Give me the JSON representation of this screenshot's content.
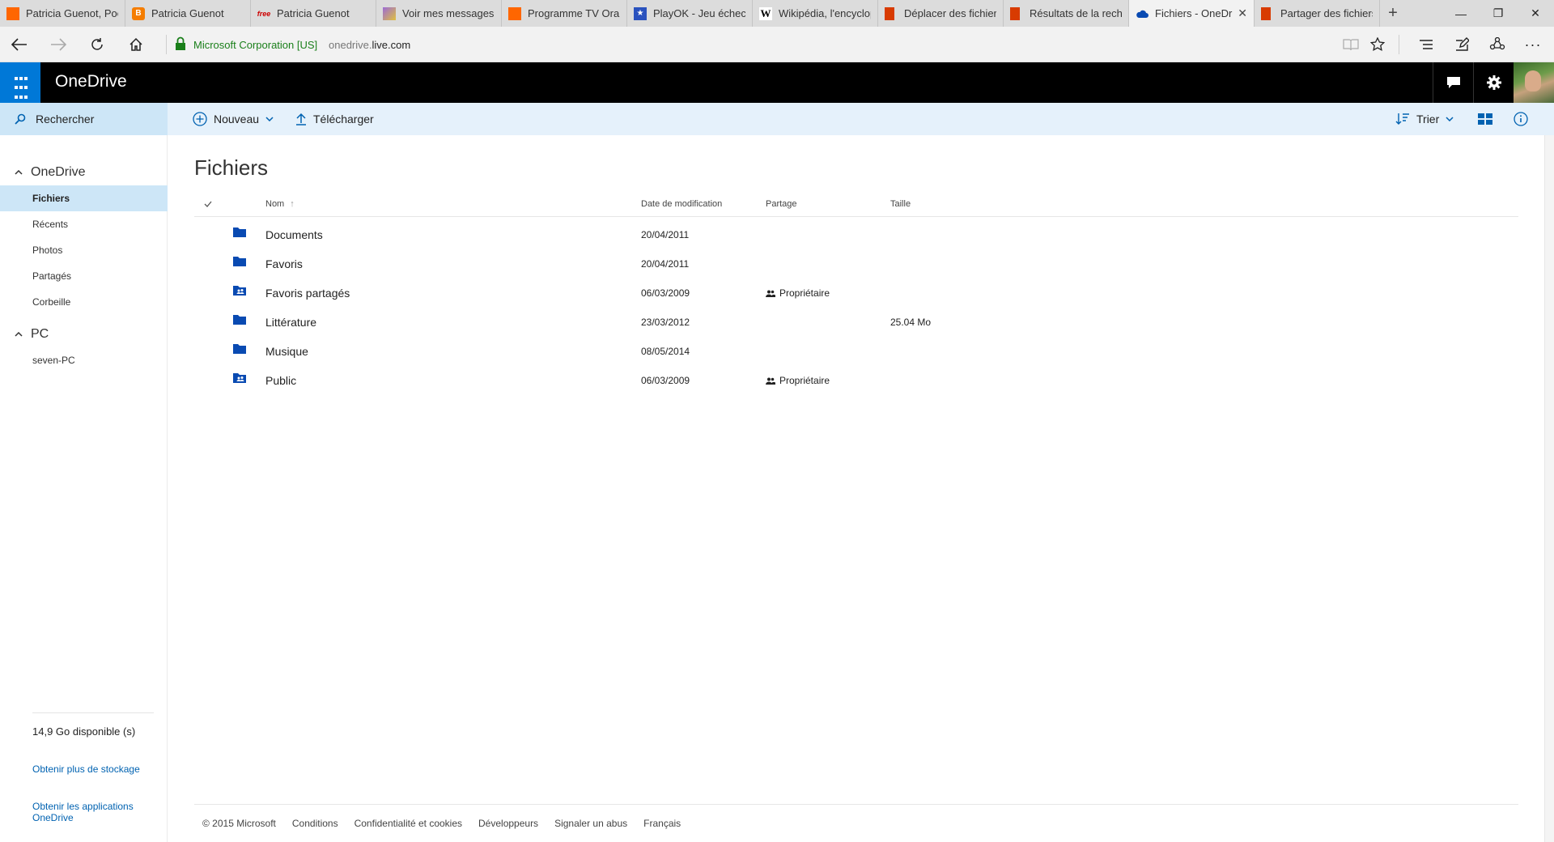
{
  "browser": {
    "tabs": [
      {
        "title": "Patricia Guenot, Poè",
        "favicon_color": "#ff6600",
        "favicon_glyph": ""
      },
      {
        "title": "Patricia Guenot",
        "favicon_color": "#f57d00",
        "favicon_glyph": "B"
      },
      {
        "title": "Patricia Guenot",
        "favicon_color": "#cc0000",
        "favicon_glyph": "free"
      },
      {
        "title": "Voir mes messages",
        "favicon_color": "#9c6bd6",
        "favicon_glyph": ""
      },
      {
        "title": "Programme TV Oran",
        "favicon_color": "#ff6600",
        "favicon_glyph": ""
      },
      {
        "title": "PlayOK - Jeu échecs",
        "favicon_color": "#2a52be",
        "favicon_glyph": "★"
      },
      {
        "title": "Wikipédia, l'encyclop",
        "favicon_color": "#ffffff",
        "favicon_glyph": "W"
      },
      {
        "title": "Déplacer des fichiers",
        "favicon_color": "#d83b01",
        "favicon_glyph": ""
      },
      {
        "title": "Résultats de la reche",
        "favicon_color": "#d83b01",
        "favicon_glyph": ""
      },
      {
        "title": "Fichiers - OneDr",
        "favicon_color": "#094ab2",
        "favicon_glyph": "☁",
        "active": true
      },
      {
        "title": "Partager des fichiers",
        "favicon_color": "#d83b01",
        "favicon_glyph": ""
      }
    ],
    "cert_label": "Microsoft Corporation [US]",
    "url_prefix": "onedrive.",
    "url_domain": "live.com"
  },
  "header": {
    "brand": "OneDrive"
  },
  "commandbar": {
    "search_label": "Rechercher",
    "new_label": "Nouveau",
    "upload_label": "Télécharger",
    "sort_label": "Trier"
  },
  "sidebar": {
    "group_onedrive": "OneDrive",
    "items": [
      {
        "label": "Fichiers",
        "selected": true
      },
      {
        "label": "Récents"
      },
      {
        "label": "Photos"
      },
      {
        "label": "Partagés"
      },
      {
        "label": "Corbeille"
      }
    ],
    "group_pc": "PC",
    "pc_items": [
      {
        "label": "seven-PC"
      }
    ],
    "quota": "14,9 Go disponible (s)",
    "more_storage": "Obtenir plus de stockage",
    "get_apps": "Obtenir les applications OneDrive"
  },
  "main": {
    "title": "Fichiers",
    "columns": {
      "name": "Nom",
      "modified": "Date de modification",
      "sharing": "Partage",
      "size": "Taille"
    },
    "rows": [
      {
        "name": "Documents",
        "date": "20/04/2011",
        "sharing": "",
        "size": "",
        "type": "folder"
      },
      {
        "name": "Favoris",
        "date": "20/04/2011",
        "sharing": "",
        "size": "",
        "type": "folder"
      },
      {
        "name": "Favoris partagés",
        "date": "06/03/2009",
        "sharing": "Propriétaire",
        "size": "",
        "type": "shared-folder"
      },
      {
        "name": "Littérature",
        "date": "23/03/2012",
        "sharing": "",
        "size": "25.04 Mo",
        "type": "folder"
      },
      {
        "name": "Musique",
        "date": "08/05/2014",
        "sharing": "",
        "size": "",
        "type": "folder"
      },
      {
        "name": "Public",
        "date": "06/03/2009",
        "sharing": "Propriétaire",
        "size": "",
        "type": "shared-folder"
      }
    ]
  },
  "footer": {
    "copyright": "© 2015 Microsoft",
    "links": [
      "Conditions",
      "Confidentialité et cookies",
      "Développeurs",
      "Signaler un abus",
      "Français"
    ]
  },
  "colors": {
    "accent": "#0078d7",
    "folder": "#094ab2",
    "link": "#0062b1",
    "commandbar_bg": "#e5f1fb",
    "selected_bg": "#cde6f7"
  }
}
